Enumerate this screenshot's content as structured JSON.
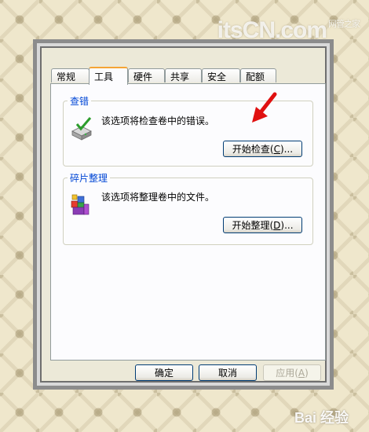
{
  "watermark_top": "itsCN.com",
  "watermark_top_small": "网管之家",
  "watermark_bottom": "Bai 经验",
  "tabs": [
    {
      "label": "常规",
      "active": false
    },
    {
      "label": "工具",
      "active": true
    },
    {
      "label": "硬件",
      "active": false
    },
    {
      "label": "共享",
      "active": false
    },
    {
      "label": "安全",
      "active": false
    },
    {
      "label": "配额",
      "active": false
    }
  ],
  "check_group": {
    "title": "查错",
    "description": "该选项将检查卷中的错误。",
    "button_text": "开始检查",
    "button_mnemonic": "C",
    "button_suffix": "...",
    "icon": "disk-check-icon"
  },
  "defrag_group": {
    "title": "碎片整理",
    "description": "该选项将整理卷中的文件。",
    "button_text": "开始整理",
    "button_mnemonic": "D",
    "button_suffix": "...",
    "icon": "defrag-icon"
  },
  "footer": {
    "ok_label": "确定",
    "cancel_label": "取消",
    "apply_text": "应用",
    "apply_mnemonic": "A"
  },
  "colors": {
    "dialog_bg": "#ece9d8",
    "panel_bg": "#fcfcfe",
    "group_title": "#0046d5",
    "button_border": "#003c74",
    "active_tab_accent": "#f5a435",
    "annotation_arrow": "#e01010"
  }
}
